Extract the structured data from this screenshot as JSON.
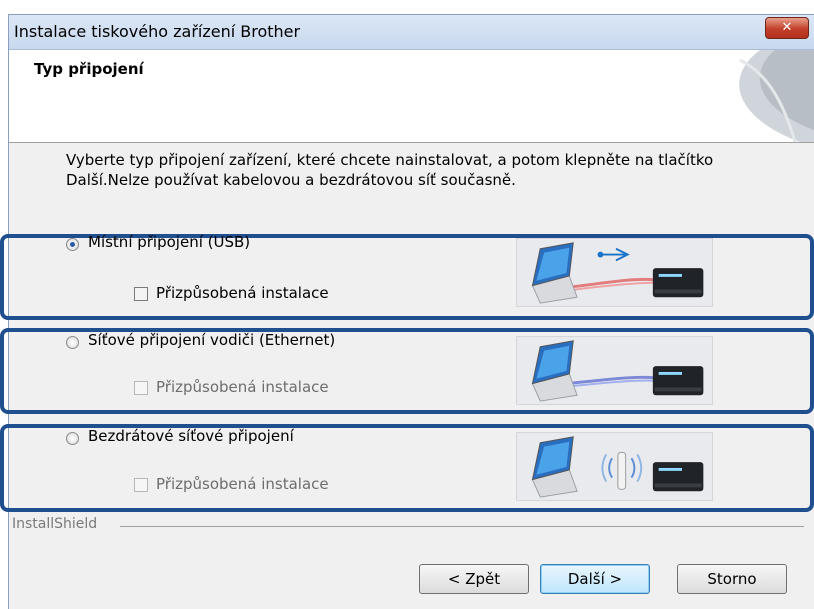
{
  "window": {
    "title": "Instalace tiskového zařízení Brother",
    "close_symbol": "✕"
  },
  "header": {
    "title": "Typ připojení"
  },
  "instruction": {
    "line1": "Vyberte typ připojení zařízení, které chcete nainstalovat, a potom klepněte na tlačítko",
    "line2": "Další.Nelze používat kabelovou a bezdrátovou síť současně."
  },
  "options": [
    {
      "label": "Místní připojení (USB)",
      "selected": true,
      "custom_install_label": "Přizpůsobená instalace",
      "custom_enabled": true,
      "illustration": "usb-connection-illustration"
    },
    {
      "label": "Síťové připojení vodiči (Ethernet)",
      "selected": false,
      "custom_install_label": "Přizpůsobená instalace",
      "custom_enabled": false,
      "illustration": "ethernet-connection-illustration"
    },
    {
      "label": "Bezdrátové síťové připojení",
      "selected": false,
      "custom_install_label": "Přizpůsobená instalace",
      "custom_enabled": false,
      "illustration": "wireless-connection-illustration"
    }
  ],
  "footer": {
    "brand": "InstallShield",
    "back_label": "< Zpět",
    "next_label": "Další >",
    "cancel_label": "Storno"
  },
  "colors": {
    "highlight_frame": "#1f4f8f",
    "usb_cable": "#e06060",
    "ethernet_cable": "#6070d0",
    "titlebar": "#c8d9ee"
  }
}
